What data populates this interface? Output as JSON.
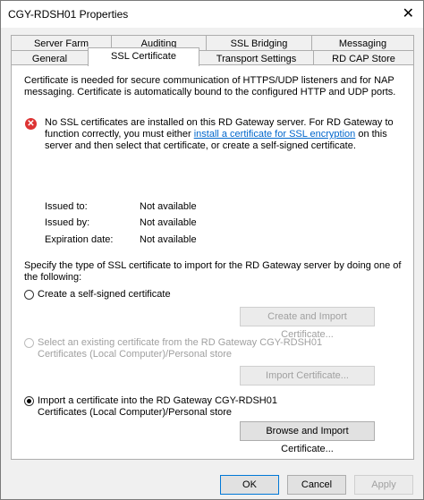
{
  "window": {
    "title": "CGY-RDSH01 Properties",
    "close_glyph": "✕"
  },
  "tabs_row1": [
    "Server Farm",
    "Auditing",
    "SSL Bridging",
    "Messaging"
  ],
  "tabs_row2": [
    "General",
    "SSL Certificate",
    "Transport Settings",
    "RD CAP Store"
  ],
  "intro": {
    "line1": "Certificate is needed for secure communication of HTTPS/UDP listeners and for NAP",
    "line2": "messaging. Certificate is automatically bound to the configured HTTP and UDP ports."
  },
  "error": {
    "line1": "No SSL certificates are installed on this RD Gateway server. For RD Gateway to",
    "line2_pre": "function correctly, you must either ",
    "line2_link": "install a certificate for SSL encryption",
    "line2_post": " on this",
    "line3": "server and then select that certificate, or create a self-signed certificate."
  },
  "cert_info": {
    "issued_to_label": "Issued to:",
    "issued_to_value": "Not available",
    "issued_by_label": "Issued by:",
    "issued_by_value": "Not available",
    "expiration_label": "Expiration date:",
    "expiration_value": "Not available"
  },
  "specify": {
    "line1": "Specify the type of SSL certificate to import for the RD Gateway server by doing one of",
    "line2": "the following:"
  },
  "options": {
    "self_signed": "Create a self-signed certificate",
    "create_import_btn": "Create and Import Certificate...",
    "existing_line1": "Select an existing certificate from the RD Gateway CGY-RDSH01",
    "existing_line2": "Certificates (Local Computer)/Personal store",
    "import_btn": "Import Certificate...",
    "import_line1": "Import a certificate into the RD Gateway CGY-RDSH01",
    "import_line2": "Certificates (Local Computer)/Personal store",
    "browse_btn": "Browse and Import Certificate...",
    "selected": "import"
  },
  "footer": {
    "ok": "OK",
    "cancel": "Cancel",
    "apply": "Apply"
  }
}
